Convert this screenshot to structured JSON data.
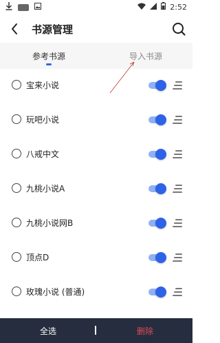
{
  "status_bar": {
    "time": "2:52"
  },
  "app_bar": {
    "title": "书源管理"
  },
  "tabs": [
    {
      "label": "参考书源",
      "active": true
    },
    {
      "label": "导入书源",
      "active": false
    }
  ],
  "sources": [
    {
      "name": "宝来小说",
      "enabled": true
    },
    {
      "name": "玩吧小说",
      "enabled": true
    },
    {
      "name": "八戒中文",
      "enabled": true
    },
    {
      "name": "九桃小说A",
      "enabled": true
    },
    {
      "name": "九桃小说网B",
      "enabled": true
    },
    {
      "name": "顶点D",
      "enabled": true
    },
    {
      "name": "玫瑰小说 (普通)",
      "enabled": true
    }
  ],
  "bottom_bar": {
    "select_all_label": "全选",
    "delete_label": "删除"
  },
  "colors": {
    "accent": "#2e63e8",
    "bottom_bar_bg": "#252d3f",
    "delete_red": "#e04b57",
    "annotation_red": "#c0392b"
  },
  "icons": {
    "back": "arrow-back-icon",
    "search": "search-icon",
    "drag": "drag-handle-icon"
  }
}
